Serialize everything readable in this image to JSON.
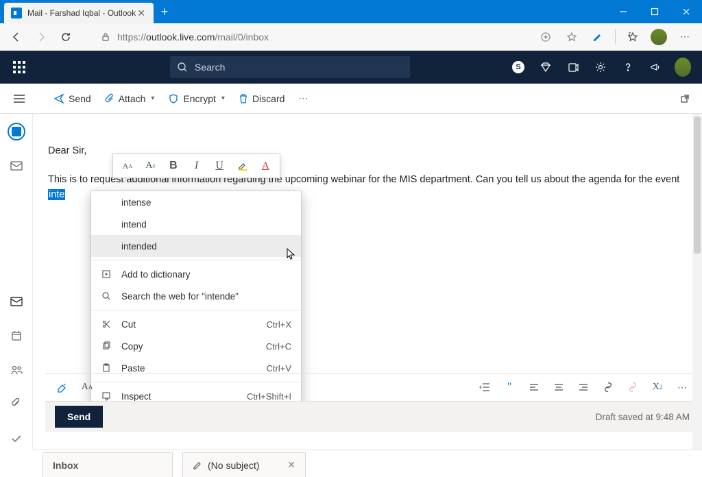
{
  "browser": {
    "tab_title": "Mail - Farshad Iqbal - Outlook",
    "url_prefix": "https://",
    "url_host": "outlook.live.com",
    "url_path": "/mail/0/inbox"
  },
  "appbar": {
    "search_placeholder": "Search"
  },
  "compose_toolbar": {
    "send": "Send",
    "attach": "Attach",
    "encrypt": "Encrypt",
    "discard": "Discard"
  },
  "body": {
    "greeting": "Dear Sir,",
    "line": "This is to request additional information regarding the upcoming webinar for the MIS department. Can you tell us about the agenda for the event ",
    "highlight": "inte"
  },
  "context_menu": {
    "suggestions": [
      "intense",
      "intend",
      "intended"
    ],
    "add_dict": "Add to dictionary",
    "search_web": "Search the web for \"intende\"",
    "cut": "Cut",
    "cut_k": "Ctrl+X",
    "copy": "Copy",
    "copy_k": "Ctrl+C",
    "paste": "Paste",
    "paste_k": "Ctrl+V",
    "inspect": "Inspect",
    "inspect_k": "Ctrl+Shift+I"
  },
  "sendbar": {
    "send": "Send",
    "draft": "Draft saved at 9:48 AM"
  },
  "bottom_tabs": {
    "inbox": "Inbox",
    "nosubject": "(No subject)"
  }
}
